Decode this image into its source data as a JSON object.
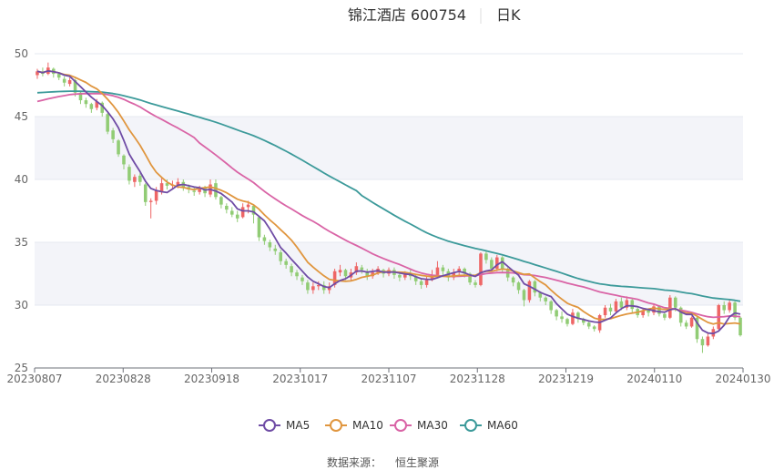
{
  "title": "锦江酒店 600754",
  "period": "日K",
  "source_label": "数据来源：",
  "source_name": "恒生聚源",
  "chart_data": {
    "type": "candlestick",
    "title": "锦江酒店 600754",
    "ylim": [
      25,
      50
    ],
    "yticks": [
      25,
      30,
      35,
      40,
      45,
      50
    ],
    "xticks": [
      "20230807",
      "20230828",
      "20230918",
      "20231017",
      "20231107",
      "20231128",
      "20231219",
      "20240110",
      "20240130"
    ],
    "legend_position": "bottom",
    "colors": {
      "up": "#ee6666",
      "down": "#91cc75",
      "MA5": "#6f4ca5",
      "MA10": "#e0963f",
      "MA30": "#d964a6",
      "MA60": "#3c9a9a"
    },
    "candles": [
      [
        48.3,
        48.6,
        48.0,
        48.8
      ],
      [
        48.6,
        48.4,
        48.2,
        48.9
      ],
      [
        48.4,
        48.9,
        48.3,
        49.3
      ],
      [
        48.8,
        48.4,
        48.1,
        48.9
      ],
      [
        48.4,
        48.1,
        47.9,
        48.5
      ],
      [
        48.0,
        47.7,
        47.4,
        48.2
      ],
      [
        47.6,
        47.9,
        47.4,
        48.1
      ],
      [
        47.9,
        46.9,
        46.6,
        48.0
      ],
      [
        46.9,
        46.3,
        46.0,
        47.0
      ],
      [
        46.3,
        46.0,
        45.7,
        46.5
      ],
      [
        46.0,
        45.6,
        45.3,
        46.1
      ],
      [
        45.7,
        46.2,
        45.5,
        46.4
      ],
      [
        46.1,
        45.3,
        45.0,
        46.2
      ],
      [
        45.2,
        43.8,
        43.6,
        45.3
      ],
      [
        43.9,
        43.2,
        42.9,
        44.1
      ],
      [
        43.1,
        42.0,
        41.8,
        43.2
      ],
      [
        41.9,
        41.2,
        40.8,
        42.0
      ],
      [
        41.0,
        39.9,
        39.6,
        41.2
      ],
      [
        39.8,
        40.2,
        39.4,
        40.4
      ],
      [
        40.3,
        39.8,
        39.5,
        40.5
      ],
      [
        39.6,
        38.2,
        37.9,
        39.7
      ],
      [
        38.2,
        38.3,
        36.9,
        38.5
      ],
      [
        38.3,
        39.1,
        38.0,
        39.4
      ],
      [
        39.0,
        39.7,
        38.8,
        40.1
      ],
      [
        39.7,
        39.5,
        39.2,
        40.0
      ],
      [
        39.5,
        39.6,
        39.2,
        39.9
      ],
      [
        39.5,
        39.8,
        39.3,
        40.1
      ],
      [
        39.8,
        39.4,
        39.1,
        40.0
      ],
      [
        39.4,
        39.2,
        38.9,
        39.6
      ],
      [
        39.1,
        39.0,
        38.7,
        39.4
      ],
      [
        39.0,
        39.3,
        38.8,
        39.5
      ],
      [
        39.3,
        38.9,
        38.6,
        39.5
      ],
      [
        38.8,
        39.6,
        38.6,
        40.0
      ],
      [
        39.7,
        38.6,
        38.4,
        40.0
      ],
      [
        38.6,
        38.0,
        37.7,
        38.7
      ],
      [
        37.9,
        37.6,
        37.3,
        38.1
      ],
      [
        37.5,
        37.2,
        37.0,
        37.8
      ],
      [
        37.2,
        36.9,
        36.6,
        37.5
      ],
      [
        37.0,
        37.8,
        36.9,
        38.1
      ],
      [
        37.8,
        38.0,
        37.3,
        38.3
      ],
      [
        37.9,
        37.2,
        36.5,
        38.0
      ],
      [
        37.0,
        35.4,
        35.1,
        37.1
      ],
      [
        35.4,
        35.1,
        34.8,
        35.6
      ],
      [
        35.0,
        34.6,
        34.3,
        35.2
      ],
      [
        34.5,
        34.3,
        34.0,
        34.8
      ],
      [
        34.2,
        33.5,
        33.2,
        34.4
      ],
      [
        33.5,
        33.2,
        32.9,
        33.7
      ],
      [
        33.1,
        32.6,
        32.3,
        33.3
      ],
      [
        32.6,
        32.3,
        32.0,
        32.8
      ],
      [
        32.2,
        31.9,
        31.6,
        32.4
      ],
      [
        31.8,
        31.2,
        30.9,
        32.0
      ],
      [
        31.2,
        31.5,
        30.9,
        31.8
      ],
      [
        31.5,
        31.6,
        31.2,
        31.9
      ],
      [
        31.6,
        31.2,
        30.9,
        31.9
      ],
      [
        31.2,
        31.5,
        30.9,
        31.8
      ],
      [
        31.6,
        32.7,
        31.4,
        32.9
      ],
      [
        32.6,
        32.8,
        32.3,
        33.2
      ],
      [
        32.8,
        32.3,
        32.0,
        32.9
      ],
      [
        32.2,
        32.6,
        31.9,
        32.9
      ],
      [
        32.6,
        33.1,
        32.4,
        33.4
      ],
      [
        33.0,
        32.8,
        32.5,
        33.2
      ],
      [
        32.7,
        32.3,
        32.0,
        32.9
      ],
      [
        32.3,
        32.6,
        32.1,
        32.9
      ],
      [
        32.6,
        32.9,
        32.4,
        33.1
      ],
      [
        32.8,
        32.5,
        32.2,
        32.9
      ],
      [
        32.5,
        32.8,
        32.3,
        33.0
      ],
      [
        32.8,
        32.4,
        32.1,
        33.0
      ],
      [
        32.4,
        32.2,
        31.9,
        32.6
      ],
      [
        32.2,
        32.5,
        32.0,
        32.7
      ],
      [
        32.5,
        32.3,
        32.0,
        32.8
      ],
      [
        32.3,
        31.9,
        31.6,
        32.5
      ],
      [
        31.9,
        31.6,
        31.3,
        32.1
      ],
      [
        31.6,
        32.0,
        31.4,
        32.3
      ],
      [
        32.0,
        32.4,
        31.9,
        32.8
      ],
      [
        32.4,
        33.0,
        32.2,
        33.5
      ],
      [
        33.0,
        32.7,
        32.4,
        33.2
      ],
      [
        32.7,
        32.2,
        31.9,
        32.9
      ],
      [
        32.2,
        32.6,
        32.0,
        32.9
      ],
      [
        32.6,
        32.9,
        32.3,
        33.1
      ],
      [
        32.9,
        32.5,
        32.2,
        33.0
      ],
      [
        32.5,
        31.8,
        31.6,
        32.6
      ],
      [
        31.8,
        31.6,
        31.4,
        32.0
      ],
      [
        31.6,
        34.1,
        31.5,
        34.2
      ],
      [
        34.1,
        33.6,
        33.3,
        34.3
      ],
      [
        33.6,
        32.9,
        32.7,
        33.8
      ],
      [
        32.9,
        33.8,
        32.7,
        34.0
      ],
      [
        33.8,
        32.9,
        32.6,
        33.9
      ],
      [
        32.9,
        32.2,
        31.9,
        33.0
      ],
      [
        32.2,
        31.8,
        31.5,
        32.3
      ],
      [
        31.8,
        31.2,
        30.9,
        31.9
      ],
      [
        31.2,
        30.4,
        29.9,
        31.3
      ],
      [
        30.4,
        31.9,
        30.2,
        32.0
      ],
      [
        31.9,
        31.0,
        30.7,
        32.0
      ],
      [
        31.0,
        30.6,
        30.3,
        31.1
      ],
      [
        30.6,
        30.3,
        30.0,
        30.7
      ],
      [
        30.3,
        29.6,
        29.3,
        30.4
      ],
      [
        29.6,
        29.1,
        28.8,
        29.7
      ],
      [
        29.1,
        28.9,
        28.6,
        29.5
      ],
      [
        28.9,
        28.5,
        28.3,
        29.0
      ],
      [
        28.5,
        29.4,
        28.4,
        29.7
      ],
      [
        29.4,
        28.9,
        28.6,
        29.5
      ],
      [
        28.9,
        28.6,
        28.4,
        29.0
      ],
      [
        28.6,
        28.3,
        28.1,
        28.8
      ],
      [
        28.3,
        28.1,
        27.9,
        28.4
      ],
      [
        28.0,
        29.2,
        27.8,
        29.3
      ],
      [
        29.2,
        29.8,
        29.0,
        30.0
      ],
      [
        29.8,
        29.5,
        29.2,
        30.1
      ],
      [
        29.5,
        30.3,
        29.3,
        30.5
      ],
      [
        30.3,
        29.8,
        29.6,
        30.6
      ],
      [
        29.8,
        30.4,
        29.6,
        30.7
      ],
      [
        30.4,
        29.7,
        29.4,
        30.5
      ],
      [
        29.7,
        29.2,
        29.0,
        29.8
      ],
      [
        29.2,
        29.6,
        29.0,
        29.8
      ],
      [
        29.6,
        29.4,
        29.1,
        29.7
      ],
      [
        29.4,
        29.9,
        29.2,
        30.1
      ],
      [
        29.9,
        29.3,
        29.1,
        30.0
      ],
      [
        29.3,
        29.0,
        28.8,
        29.4
      ],
      [
        29.0,
        30.6,
        28.9,
        30.8
      ],
      [
        30.6,
        29.8,
        29.5,
        30.7
      ],
      [
        29.8,
        28.6,
        28.3,
        29.9
      ],
      [
        28.6,
        28.3,
        28.1,
        28.8
      ],
      [
        28.3,
        29.0,
        28.2,
        29.1
      ],
      [
        29.0,
        27.3,
        27.0,
        29.1
      ],
      [
        27.3,
        26.8,
        26.2,
        27.5
      ],
      [
        26.8,
        27.5,
        26.7,
        27.8
      ],
      [
        27.5,
        28.1,
        27.3,
        28.3
      ],
      [
        28.1,
        30.0,
        28.0,
        30.1
      ],
      [
        30.0,
        29.6,
        29.3,
        30.3
      ],
      [
        29.6,
        30.2,
        29.4,
        30.4
      ],
      [
        30.2,
        29.0,
        28.8,
        30.3
      ],
      [
        29.0,
        27.6,
        27.5,
        29.1
      ]
    ]
  }
}
